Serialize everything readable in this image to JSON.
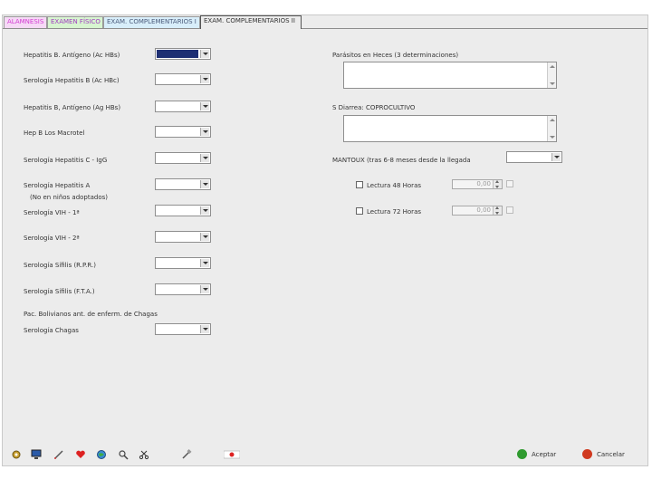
{
  "tabs": [
    {
      "label": "ALAMNESIS",
      "color": "#d23bd2",
      "bg": "#f6d9f6"
    },
    {
      "label": "EXAMEN FÍSICO",
      "color": "#a03cc0",
      "bg": "#d7f5d0"
    },
    {
      "label": "EXAM. COMPLEMENTARIOS I",
      "color": "#4a5a7a",
      "bg": "#d8eefa"
    },
    {
      "label": "EXAM. COMPLEMENTARIOS II",
      "color": "#333333",
      "bg": "#ececec"
    }
  ],
  "left_fields": [
    {
      "label": "Hepatitis B. Antígeno (Ac HBs)",
      "value_filled": true
    },
    {
      "label": "Serología Hepatitis B (Ac HBc)",
      "value_filled": false
    },
    {
      "label": "Hepatitis B, Antígeno (Ag HBs)",
      "value_filled": false
    },
    {
      "label": "Hep B Los Macrotel",
      "value_filled": false
    },
    {
      "label": "Serología Hepatitis C - IgG",
      "value_filled": false
    },
    {
      "label": "Serología Hepatitis A",
      "sublabel": "(No en niños adoptados)",
      "value_filled": false
    },
    {
      "label": "Serología VIH - 1ª",
      "value_filled": false
    },
    {
      "label": "Serología VIH - 2ª",
      "value_filled": false
    },
    {
      "label": "Serología Sífilis (R.P.R.)",
      "value_filled": false
    },
    {
      "label": "Serología Sífilis (F.T.A.)",
      "value_filled": false
    }
  ],
  "chagas_section": {
    "header": "Pac. Bolivianos ant. de enferm. de Chagas",
    "label": "Serología Chagas"
  },
  "right": {
    "parasites_label": "Parásitos en Heces (3 determinaciones)",
    "coprocultivo_label": "S Diarrea: COPROCULTIVO",
    "mantoux_label": "MANTOUX (tras 6-8 meses desde la llegada",
    "lectura48_label": "Lectura 48 Horas",
    "lectura48_value": "0,00",
    "lectura72_label": "Lectura 72 Horas",
    "lectura72_value": "0,00"
  },
  "toolbar": {
    "icons": [
      "settings-icon",
      "monitor-icon",
      "pen-icon",
      "heart-icon",
      "globe-icon",
      "magnifier-icon",
      "scissors-icon",
      "tools-icon",
      "flag-icon"
    ],
    "accept_label": "Aceptar",
    "cancel_label": "Cancelar",
    "accept_color": "#2f9a2f",
    "cancel_color": "#d0391f"
  },
  "colors": {
    "selected_value": "#1e2f73"
  }
}
